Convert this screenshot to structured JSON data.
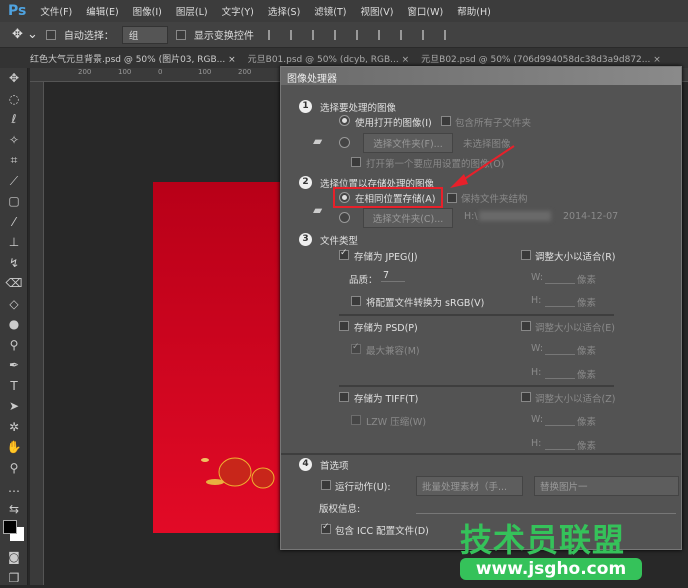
{
  "app": {
    "logo": "Ps",
    "menu": [
      "文件(F)",
      "编辑(E)",
      "图像(I)",
      "图层(L)",
      "文字(Y)",
      "选择(S)",
      "滤镜(T)",
      "视图(V)",
      "窗口(W)",
      "帮助(H)"
    ]
  },
  "options": {
    "auto_select_label": "自动选择：",
    "auto_select_value": "组",
    "show_transform_label": "显示变换控件"
  },
  "tabs": [
    "红色大气元旦背景.psd @ 50% (图片03, RGB... ×",
    "元旦B01.psd @ 50% (dcyb, RGB... ×",
    "元旦B02.psd @ 50% (706d994058dc38d3a9d872... ×"
  ],
  "ruler_top": [
    "200",
    "100",
    "0",
    "100",
    "200"
  ],
  "dialog": {
    "title": "图像处理器",
    "s1": {
      "num": "1",
      "title": "选择要处理的图像",
      "use_open": "使用打开的图像(I)",
      "include_sub": "包含所有子文件夹",
      "choose_folder": "选择文件夹(F)...",
      "no_image": "未选择图像",
      "open_first": "打开第一个要应用设置的图像(O)"
    },
    "s2": {
      "num": "2",
      "title": "选择位置以存储处理的图像",
      "same_loc": "在相同位置存储(A)",
      "keep_struct": "保持文件夹结构",
      "choose_folder": "选择文件夹(C)...",
      "path": "H:\\",
      "date": "2014-12-07"
    },
    "s3": {
      "num": "3",
      "title": "文件类型",
      "jpeg": "存储为 JPEG(J)",
      "quality_label": "品质：",
      "quality": "7",
      "srgb": "将配置文件转换为 sRGB(V)",
      "psd": "存储为 PSD(P)",
      "max_compat": "最大兼容(M)",
      "tiff": "存储为 TIFF(T)",
      "lzw": "LZW 压缩(W)",
      "resize_r": "调整大小以适合(R)",
      "resize_e": "调整大小以适合(E)",
      "resize_z": "调整大小以适合(Z)",
      "w": "W:",
      "h": "H:",
      "px": "像素"
    },
    "s4": {
      "num": "4",
      "title": "首选项",
      "run_action": "运行动作(U):",
      "action_set": "批量处理素材（手...",
      "action": "替换图片一",
      "copyright": "版权信息:",
      "icc": "包含 ICC 配置文件(D)"
    }
  },
  "watermark": {
    "name": "技术员联盟",
    "url": "www.jsgho.com"
  },
  "colors": {
    "highlight": "#e8202a",
    "watermark": "#35c25a"
  }
}
